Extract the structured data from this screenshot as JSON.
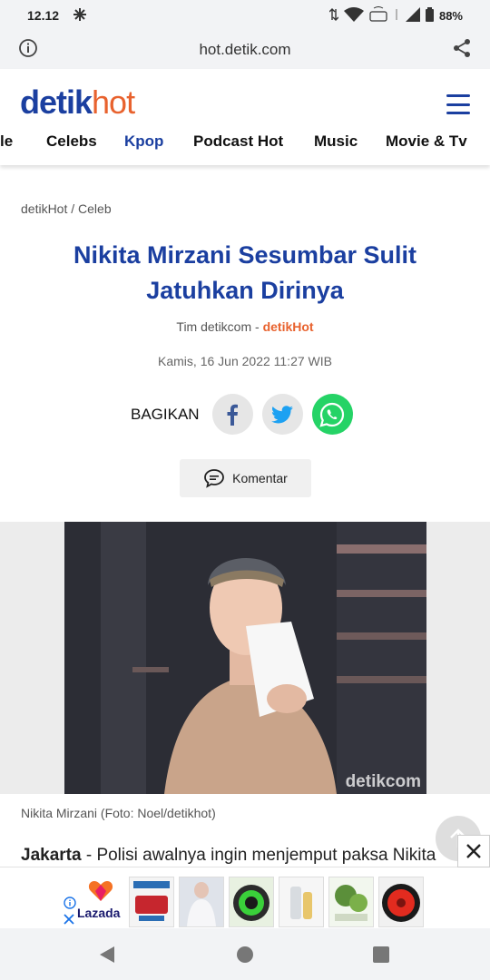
{
  "status_bar": {
    "time": "12.12",
    "battery": "88%"
  },
  "browser": {
    "url": "hot.detik.com"
  },
  "site": {
    "logo_part1": "detik",
    "logo_part2": "hot",
    "nav": [
      {
        "label": "le"
      },
      {
        "label": "Celebs"
      },
      {
        "label": "Kpop",
        "active": true
      },
      {
        "label": "Podcast Hot"
      },
      {
        "label": "Music"
      },
      {
        "label": "Movie & Tv"
      }
    ]
  },
  "article": {
    "breadcrumb": "detikHot / Celeb",
    "title": "Nikita Mirzani Sesumbar Sulit Jatuhkan Dirinya",
    "author": "Tim detikcom",
    "byline_sep": " - ",
    "source": "detikHot",
    "date": "Kamis, 16 Jun 2022 11:27 WIB",
    "share_label": "BAGIKAN",
    "comment_label": "Komentar",
    "photo_watermark": "detikcom",
    "caption": "Nikita Mirzani (Foto: Noel/detikhot)",
    "lead_place": "Jakarta",
    "lead_text": " - Polisi awalnya ingin menjemput paksa Nikita"
  },
  "ad": {
    "brand": "Lazada"
  },
  "colors": {
    "brand_blue": "#1b3fa0",
    "brand_orange": "#e8622e",
    "whatsapp": "#25d366",
    "facebook": "#3b5998",
    "twitter": "#1da1f2"
  }
}
